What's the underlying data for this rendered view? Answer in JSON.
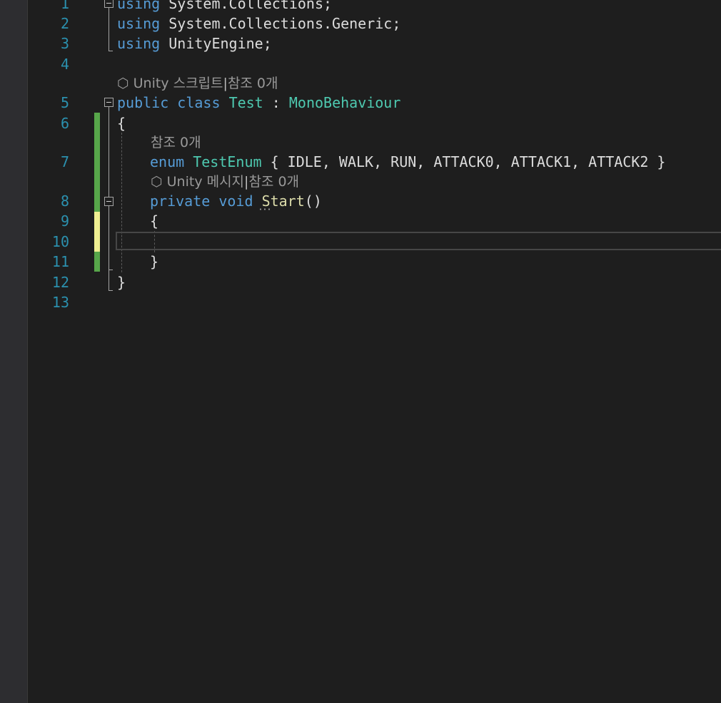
{
  "editor": {
    "line_numbers": [
      "1",
      "2",
      "3",
      "4",
      "5",
      "6",
      "7",
      "8",
      "9",
      "10",
      "11",
      "12",
      "13"
    ],
    "code": {
      "l1": {
        "kw": "using",
        "rest": " System.Collections;"
      },
      "l2": {
        "kw": "using",
        "rest": " System.Collections.Generic;"
      },
      "l3": {
        "kw": "using",
        "rest": " UnityEngine;"
      },
      "lens_class": {
        "icon": "unity-icon",
        "text1": "Unity 스크립트",
        "sep": "|",
        "text2": "참조 0개"
      },
      "l5": {
        "kw1": "public",
        "kw2": "class",
        "name": "Test",
        "colon": " : ",
        "base": "MonoBehaviour"
      },
      "l6": {
        "brace": "{"
      },
      "lens_enum": {
        "text": "참조 0개"
      },
      "l7": {
        "kw": "enum",
        "name": "TestEnum",
        "body": " { IDLE, WALK, RUN, ATTACK0, ATTACK1, ATTACK2 }"
      },
      "lens_start": {
        "icon": "unity-icon",
        "text1": "Unity 메시지",
        "sep": "|",
        "text2": "참조 0개"
      },
      "l8": {
        "kw1": "private",
        "kw2": "void",
        "method": "Start",
        "parens": "()"
      },
      "l9": {
        "brace": "{"
      },
      "l11": {
        "brace": "}"
      },
      "l12": {
        "brace": "}"
      }
    },
    "colors": {
      "keyword": "#569cd6",
      "type": "#4ec9b0",
      "method": "#dcdcaa",
      "line_number": "#2b91af",
      "change_saved": "#57a64a",
      "change_unsaved": "#efef91"
    }
  }
}
